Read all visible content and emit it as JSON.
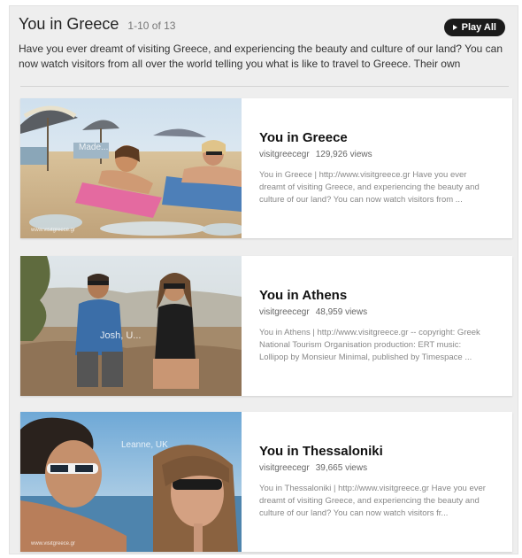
{
  "playlist": {
    "title": "You in Greece",
    "count": "1-10 of 13",
    "play_all": "Play All",
    "description": "Have you ever dreamt of visiting Greece, and experiencing the beauty and culture of our land? You can now watch visitors from all over the world telling you what is like to travel to Greece. Their own testimonies \"bring to"
  },
  "videos": [
    {
      "title": "You in Greece",
      "channel": "visitgreecegr",
      "views": "129,926 views",
      "description": "You in Greece | http://www.visitgreece.gr Have you ever dreamt of visiting Greece, and experiencing the beauty and culture of our land? You can now watch visitors from ...",
      "watermark": "www.visitgreece.gr",
      "overlay": "Made..."
    },
    {
      "title": "You in Athens",
      "channel": "visitgreecegr",
      "views": "48,959 views",
      "description": "You in Athens | http://www.visitgreece.gr -- copyright: Greek National Tourism Organisation production: ERT music: Lollipop by Monsieur Minimal, published by Timespace ...",
      "overlay": "Josh, U..."
    },
    {
      "title": "You in Thessaloniki",
      "channel": "visitgreecegr",
      "views": "39,665 views",
      "description": "You in Thessaloniki | http://www.visitgreece.gr Have you ever dreamt of visiting Greece, and experiencing the beauty and culture of our land? You can now watch visitors fr...",
      "watermark": "www.visitgreece.gr",
      "overlay": "Leanne, UK"
    }
  ]
}
